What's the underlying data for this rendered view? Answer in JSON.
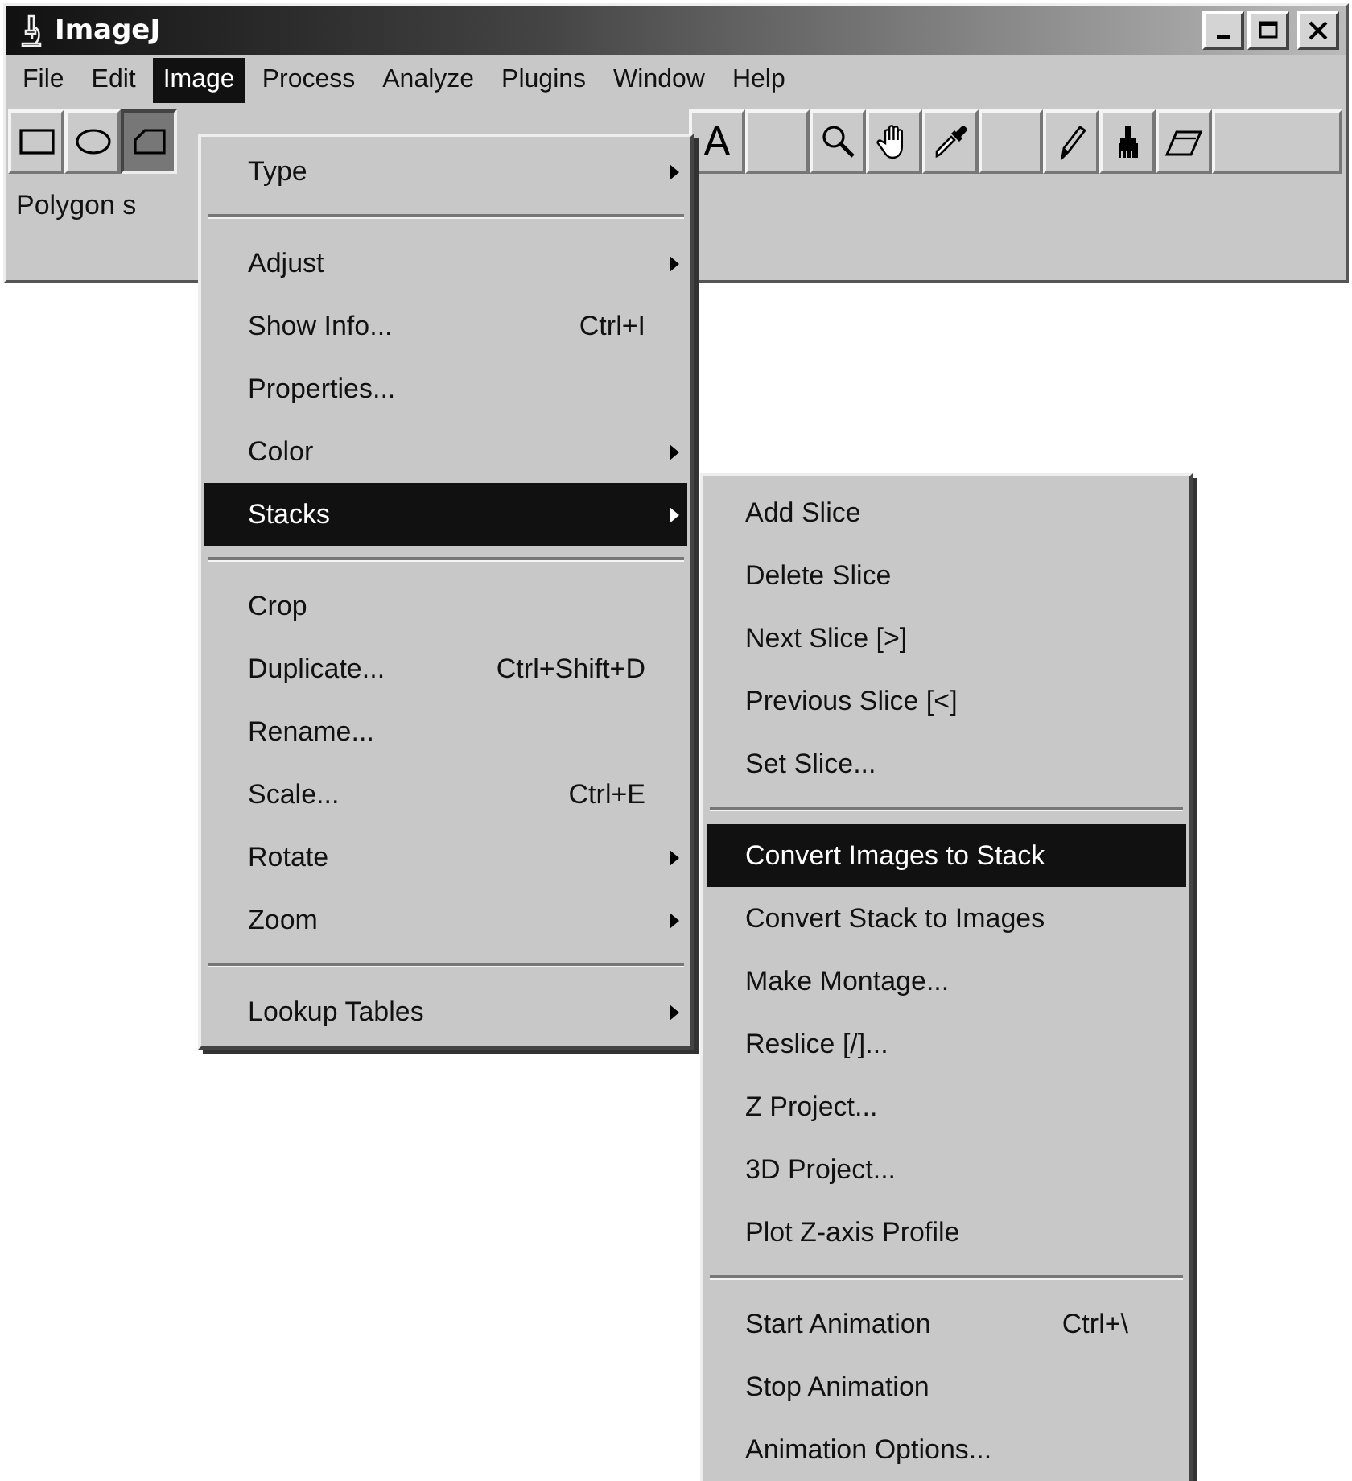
{
  "window": {
    "title": "ImageJ"
  },
  "menu_bar": [
    {
      "label": "File",
      "selected": false
    },
    {
      "label": "Edit",
      "selected": false
    },
    {
      "label": "Image",
      "selected": true
    },
    {
      "label": "Process",
      "selected": false
    },
    {
      "label": "Analyze",
      "selected": false
    },
    {
      "label": "Plugins",
      "selected": false
    },
    {
      "label": "Window",
      "selected": false
    },
    {
      "label": "Help",
      "selected": false
    }
  ],
  "toolbar": {
    "left_tools": [
      {
        "kind": "rectangle",
        "selected": false
      },
      {
        "kind": "oval",
        "selected": false
      },
      {
        "kind": "polygon",
        "selected": true
      }
    ],
    "right_tools": [
      {
        "kind": "text",
        "glyph": "A",
        "selected": false
      },
      {
        "kind": "blank",
        "selected": false
      },
      {
        "kind": "magnifier",
        "selected": false
      },
      {
        "kind": "hand",
        "selected": false
      },
      {
        "kind": "dropper",
        "selected": false
      },
      {
        "kind": "blank",
        "selected": false
      },
      {
        "kind": "pencil",
        "selected": false
      },
      {
        "kind": "brush",
        "selected": false
      },
      {
        "kind": "eraser",
        "selected": false
      },
      {
        "kind": "blank",
        "selected": false
      }
    ]
  },
  "status_bar": {
    "text": "Polygon s"
  },
  "image_menu": {
    "items": [
      {
        "kind": "item",
        "label": "Type",
        "has_submenu": true,
        "selected": false
      },
      {
        "kind": "separator"
      },
      {
        "kind": "item",
        "label": "Adjust",
        "has_submenu": true,
        "selected": false
      },
      {
        "kind": "item",
        "label": "Show Info...",
        "shortcut": "Ctrl+I",
        "has_submenu": false,
        "selected": false
      },
      {
        "kind": "item",
        "label": "Properties...",
        "has_submenu": false,
        "selected": false
      },
      {
        "kind": "item",
        "label": "Color",
        "has_submenu": true,
        "selected": false
      },
      {
        "kind": "item",
        "label": "Stacks",
        "has_submenu": true,
        "selected": true
      },
      {
        "kind": "separator"
      },
      {
        "kind": "item",
        "label": "Crop",
        "has_submenu": false,
        "selected": false
      },
      {
        "kind": "item",
        "label": "Duplicate...",
        "shortcut": "Ctrl+Shift+D",
        "has_submenu": false,
        "selected": false
      },
      {
        "kind": "item",
        "label": "Rename...",
        "has_submenu": false,
        "selected": false
      },
      {
        "kind": "item",
        "label": "Scale...",
        "shortcut": "Ctrl+E",
        "has_submenu": false,
        "selected": false
      },
      {
        "kind": "item",
        "label": "Rotate",
        "has_submenu": true,
        "selected": false
      },
      {
        "kind": "item",
        "label": "Zoom",
        "has_submenu": true,
        "selected": false
      },
      {
        "kind": "separator"
      },
      {
        "kind": "item",
        "label": "Lookup Tables",
        "has_submenu": true,
        "selected": false
      }
    ]
  },
  "stacks_submenu": {
    "items": [
      {
        "kind": "item",
        "label": "Add Slice",
        "selected": false
      },
      {
        "kind": "item",
        "label": "Delete Slice",
        "selected": false
      },
      {
        "kind": "item",
        "label": "Next Slice [>]",
        "selected": false
      },
      {
        "kind": "item",
        "label": "Previous Slice [<]",
        "selected": false
      },
      {
        "kind": "item",
        "label": "Set Slice...",
        "selected": false
      },
      {
        "kind": "separator"
      },
      {
        "kind": "item",
        "label": "Convert Images to Stack",
        "selected": true
      },
      {
        "kind": "item",
        "label": "Convert Stack to Images",
        "selected": false
      },
      {
        "kind": "item",
        "label": "Make Montage...",
        "selected": false
      },
      {
        "kind": "item",
        "label": "Reslice [/]...",
        "selected": false
      },
      {
        "kind": "item",
        "label": "Z Project...",
        "selected": false
      },
      {
        "kind": "item",
        "label": "3D Project...",
        "selected": false
      },
      {
        "kind": "item",
        "label": "Plot Z-axis Profile",
        "selected": false
      },
      {
        "kind": "separator"
      },
      {
        "kind": "item",
        "label": "Start Animation",
        "shortcut": "Ctrl+\\",
        "selected": false
      },
      {
        "kind": "item",
        "label": "Stop Animation",
        "selected": false
      },
      {
        "kind": "item",
        "label": "Animation Options...",
        "selected": false
      }
    ]
  }
}
